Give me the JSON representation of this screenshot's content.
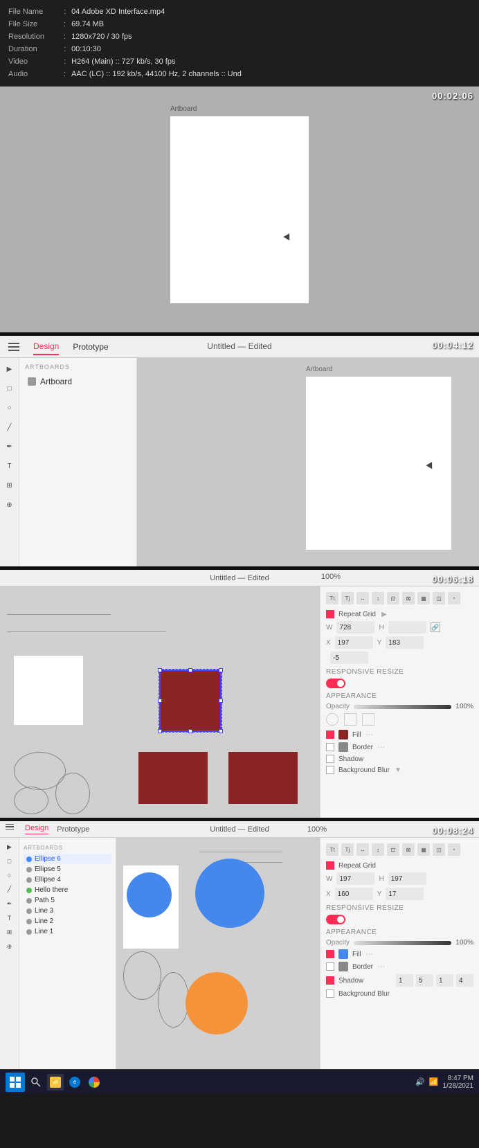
{
  "file": {
    "name_label": "File Name",
    "name_value": "04 Adobe XD Interface.mp4",
    "size_label": "File Size",
    "size_value": "69.74 MB",
    "resolution_label": "Resolution",
    "resolution_value": "1280x720 / 30 fps",
    "duration_label": "Duration",
    "duration_value": "00:10:30",
    "video_label": "Video",
    "video_value": "H264 (Main) :: 727 kb/s, 30 fps",
    "audio_label": "Audio",
    "audio_value": "AAC (LC) :: 192 kb/s, 44100 Hz, 2 channels :: Und"
  },
  "section1": {
    "timestamp": "00:02:06",
    "artboard_label": "Artboard"
  },
  "section2": {
    "timestamp": "00:04:12",
    "title": "Untitled — Edited",
    "tab_design": "Design",
    "tab_prototype": "Prototype",
    "menu_label": "☰",
    "artboard_label": "Artboard",
    "sidebar_section": "ARTBOARDS",
    "sidebar_item": "Artboard"
  },
  "section3": {
    "timestamp": "00:06:18",
    "title": "Untitled — Edited",
    "zoom": "100%",
    "panel_section_repeat": "Repeat Grid",
    "width_label": "W",
    "width_value": "728",
    "height_label": "H",
    "x_label": "X",
    "x_value": "197",
    "y_label": "Y",
    "y_value": "183",
    "y_value2": "-5",
    "responsive_label": "RESPONSIVE RESIZE",
    "appearance_label": "APPEARANCE",
    "opacity_label": "Opacity",
    "opacity_value": "100%",
    "fill_label": "Fill",
    "border_label": "Border",
    "shadow_label": "Shadow",
    "bg_blur_label": "Background Blur"
  },
  "section4": {
    "timestamp": "00:08:24",
    "title": "Untitled — Edited",
    "zoom": "100%",
    "tab_design": "Design",
    "tab_prototype": "Prototype",
    "sidebar_section": "ARTBOARDS",
    "layers": [
      "Ellipse 6",
      "Ellipse 5",
      "Ellipse 4",
      "Hello there",
      "Path 5",
      "Line 3",
      "Line 2",
      "Line 1"
    ],
    "selected_layer": "Ellipse 6",
    "repeat_grid_label": "Repeat Grid",
    "width_value": "197",
    "height_value": "197",
    "x_value": "160",
    "y_value": "17",
    "responsive_label": "RESPONSIVE RESIZE",
    "appearance_label": "APPEARANCE",
    "opacity_value": "100%",
    "fill_label": "Fill",
    "border_label": "Border",
    "shadow_label": "Shadow",
    "bg_blur_label": "Background Blur"
  },
  "taskbar": {
    "time": "8:47 PM",
    "date": "1/28/2021"
  }
}
